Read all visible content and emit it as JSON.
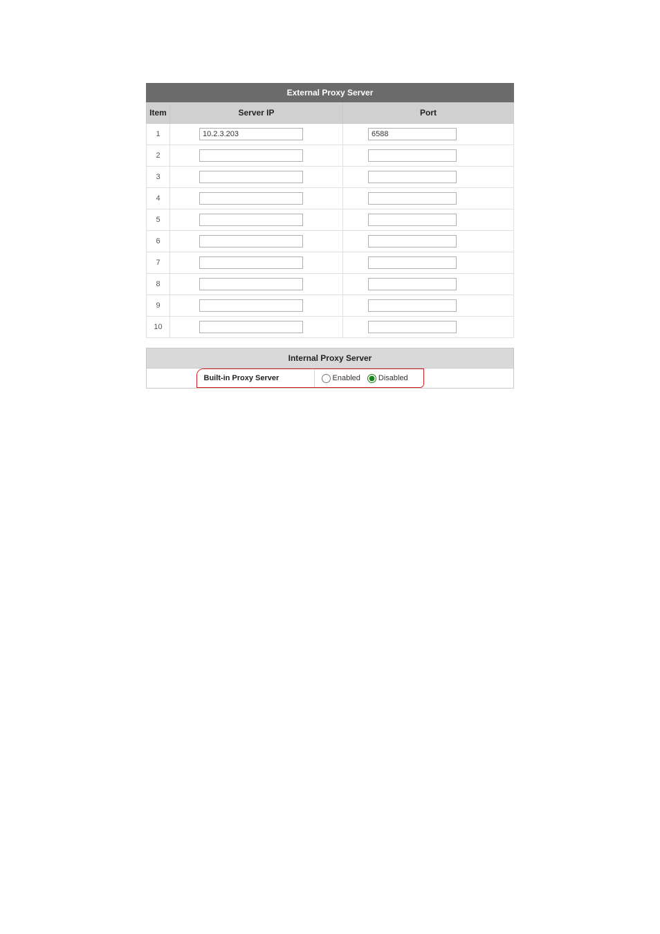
{
  "external": {
    "title": "External Proxy Server",
    "headers": {
      "item": "Item",
      "server_ip": "Server IP",
      "port": "Port"
    },
    "rows": [
      {
        "item": "1",
        "server_ip": "10.2.3.203",
        "port": "6588"
      },
      {
        "item": "2",
        "server_ip": "",
        "port": ""
      },
      {
        "item": "3",
        "server_ip": "",
        "port": ""
      },
      {
        "item": "4",
        "server_ip": "",
        "port": ""
      },
      {
        "item": "5",
        "server_ip": "",
        "port": ""
      },
      {
        "item": "6",
        "server_ip": "",
        "port": ""
      },
      {
        "item": "7",
        "server_ip": "",
        "port": ""
      },
      {
        "item": "8",
        "server_ip": "",
        "port": ""
      },
      {
        "item": "9",
        "server_ip": "",
        "port": ""
      },
      {
        "item": "10",
        "server_ip": "",
        "port": ""
      }
    ]
  },
  "internal": {
    "title": "Internal Proxy Server",
    "row_label": "Built-in Proxy Server",
    "options": {
      "enabled": "Enabled",
      "disabled": "Disabled"
    },
    "selected": "disabled"
  }
}
